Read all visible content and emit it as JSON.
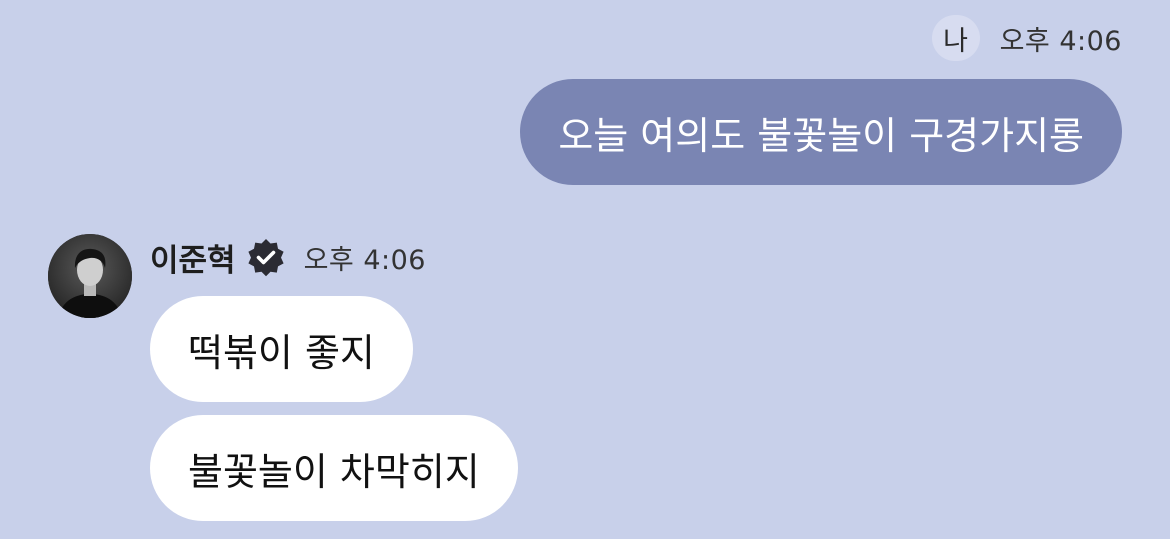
{
  "colors": {
    "background": "#c8d0ea",
    "outgoing_bubble": "#7a85b3",
    "incoming_bubble": "#ffffff",
    "my_badge": "#d7dcf0"
  },
  "me": {
    "badge_label": "나",
    "time": "오후 4:06",
    "messages": [
      {
        "text": "오늘 여의도 불꽃놀이 구경가지롱"
      }
    ]
  },
  "friend": {
    "name": "이준혁",
    "avatar": "profile-photo",
    "verified_icon": "verified-badge-icon",
    "time": "오후 4:06",
    "messages": [
      {
        "text": "떡볶이 좋지"
      },
      {
        "text": "불꽃놀이 차막히지"
      }
    ]
  }
}
